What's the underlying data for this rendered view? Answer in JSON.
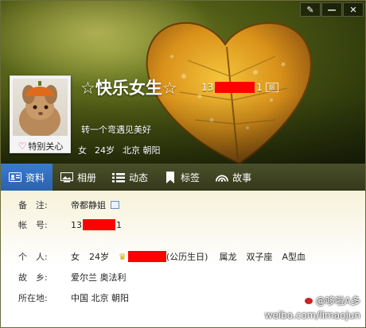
{
  "window_controls": {
    "skin": "✎",
    "minimize": "—",
    "close": "✕"
  },
  "profile": {
    "nickname": "☆快乐女生☆",
    "uid_prefix": "13",
    "uid_suffix": "1",
    "level_badge": "靓",
    "motto": "转一个弯遇见美好",
    "gender": "女",
    "age": "24岁",
    "location": "北京 朝阳",
    "follow_label": "特别关心"
  },
  "tabs": [
    {
      "label": "资料",
      "icon": "profile-card-icon",
      "active": true
    },
    {
      "label": "相册",
      "icon": "photo-album-icon",
      "active": false
    },
    {
      "label": "动态",
      "icon": "feed-list-icon",
      "active": false
    },
    {
      "label": "标签",
      "icon": "bookmark-tag-icon",
      "active": false
    },
    {
      "label": "故事",
      "icon": "broadcast-story-icon",
      "active": false
    }
  ],
  "details": {
    "remark_label": "备　注:",
    "remark_value": "帝都静姐",
    "account_label": "帐　号:",
    "account_prefix": "13",
    "account_suffix": "1",
    "personal_label": "个　人:",
    "personal_gender": "女",
    "personal_age": "24岁",
    "birthday_note": "(公历生日)",
    "zodiac": "属龙",
    "constellation": "双子座",
    "blood_type": "A型血",
    "hometown_label": "故　乡:",
    "hometown_value": "爱尔兰 奥法利",
    "location_label": "所在地:",
    "location_value": "中国 北京 朝阳"
  },
  "watermark": {
    "line1": "@哆啦A多",
    "line2": "weibo.com/limaojun"
  }
}
